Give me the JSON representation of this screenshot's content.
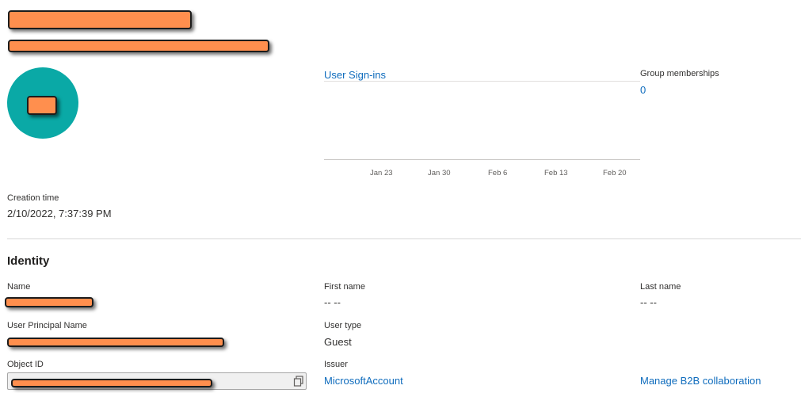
{
  "header": {
    "display_name": "",
    "subtitle": ""
  },
  "avatar": {
    "initials": "",
    "color": "#0aa9a6"
  },
  "sign_ins": {
    "link_label": "User Sign-ins",
    "ticks": [
      "Jan 23",
      "Jan 30",
      "Feb 6",
      "Feb 13",
      "Feb 20"
    ]
  },
  "groups": {
    "label": "Group memberships",
    "value": "0"
  },
  "creation": {
    "label": "Creation time",
    "value": "2/10/2022, 7:37:39 PM"
  },
  "identity": {
    "heading": "Identity",
    "name": {
      "label": "Name",
      "value": ""
    },
    "first_name": {
      "label": "First name",
      "value": "-- --"
    },
    "last_name": {
      "label": "Last name",
      "value": "-- --"
    },
    "upn": {
      "label": "User Principal Name",
      "value": ""
    },
    "user_type": {
      "label": "User type",
      "value": "Guest"
    },
    "object_id": {
      "label": "Object ID",
      "value": ""
    },
    "issuer": {
      "label": "Issuer",
      "value": "MicrosoftAccount"
    },
    "manage_b2b": "Manage B2B collaboration"
  },
  "colors": {
    "link": "#0f6cbd",
    "redaction": "#ff8f4e"
  }
}
